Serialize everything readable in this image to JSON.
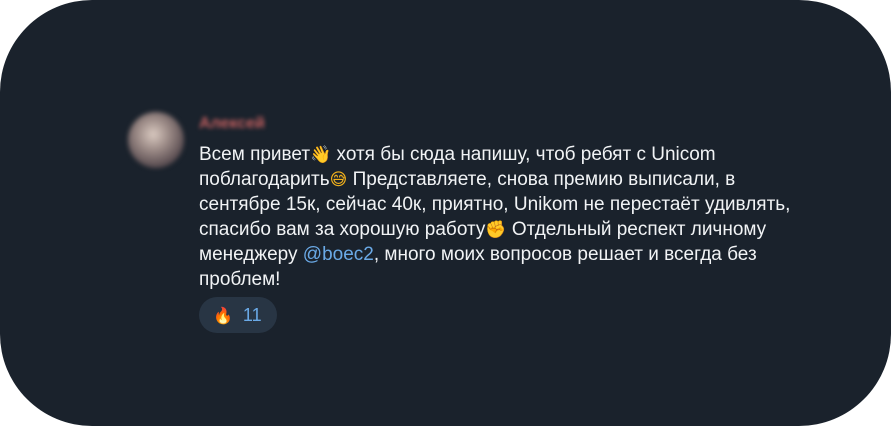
{
  "post": {
    "author": "Алексей",
    "lines": [
      [
        "Всем привет",
        "👋",
        " хотя бы сюда напишу, чтоб ребят с Unicom"
      ],
      [
        "поблагодарить",
        "😅",
        " Представляете, снова премию выписали, в"
      ],
      [
        "сентябре 15к, сейчас 40к, приятно, Unikom не перестаёт удивлять,"
      ],
      [
        "спасибо вам за хорошую работу",
        "✊",
        " Отдельный респект личному"
      ],
      [
        "менеджеру ",
        "@boec2",
        ", много моих вопросов решает и всегда без"
      ],
      [
        "проблем!"
      ]
    ],
    "reaction": {
      "icon": "fire-icon",
      "emoji": "🔥",
      "count": "11"
    }
  },
  "colors": {
    "background": "#1a222c",
    "text": "#f1f3f5",
    "mention": "#6aa9e6",
    "author": "#c15f5f",
    "reaction_bg": "#283544"
  }
}
